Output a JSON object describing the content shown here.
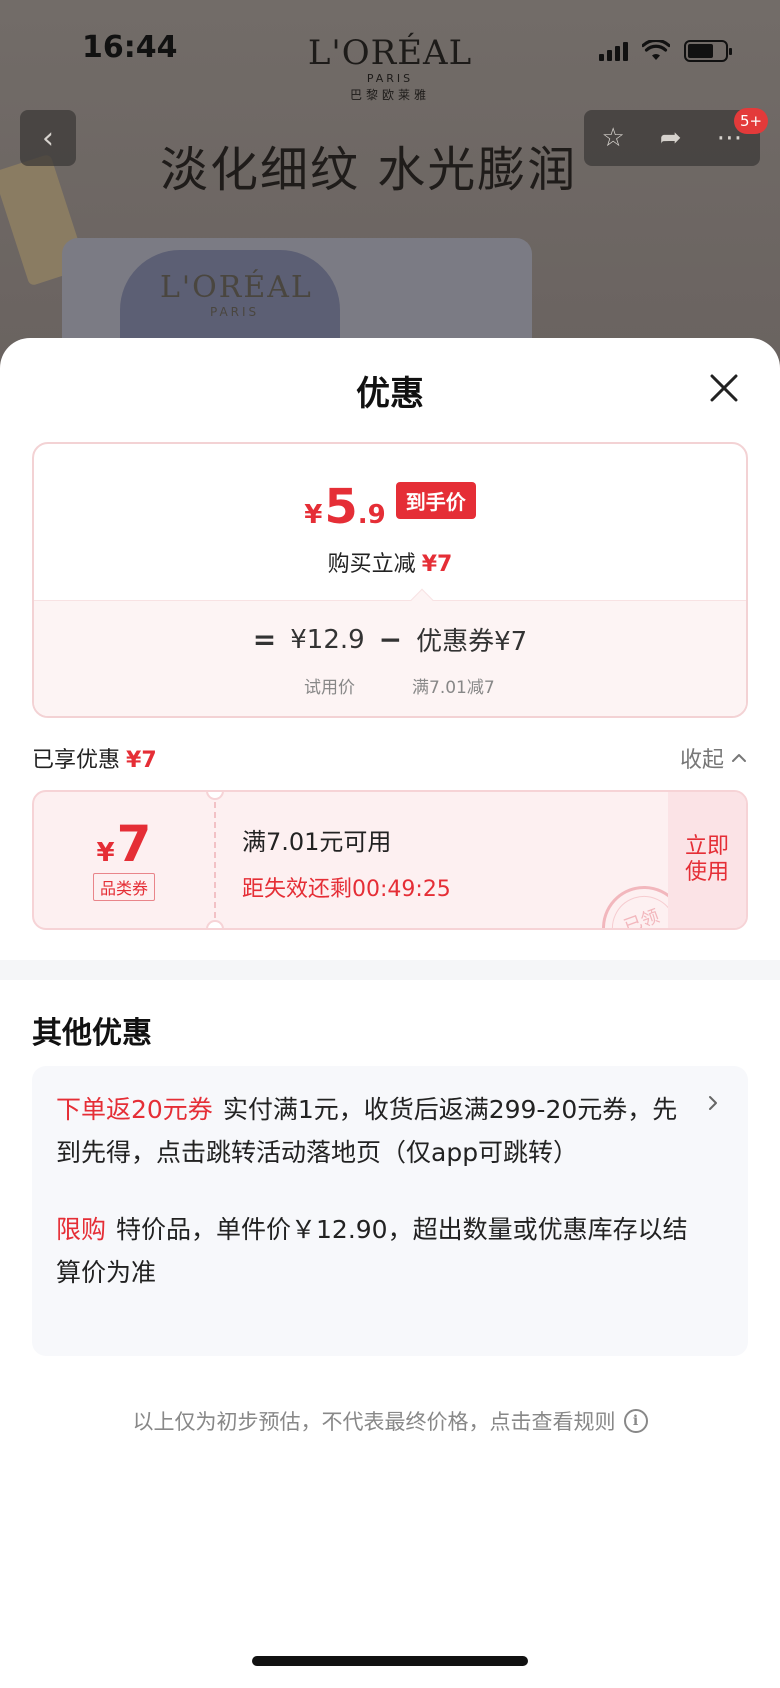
{
  "status_bar": {
    "time": "16:44"
  },
  "brand": {
    "name": "L'ORÉAL",
    "sub": "PARIS",
    "cn": "巴黎欧莱雅"
  },
  "background_page": {
    "heading": "淡化细纹 水光膨润",
    "box_brand": "L'ORÉAL",
    "box_sub": "PARIS",
    "badge": "5+",
    "icons": [
      "back-icon",
      "star-icon",
      "share-icon",
      "more-icon"
    ]
  },
  "sheet": {
    "title": "优惠",
    "price_card": {
      "currency": "¥",
      "final_int": "5",
      "final_dec": ".9",
      "final_tag": "到手价",
      "saving_label": "购买立减",
      "saving_value": "¥7",
      "eq": "=",
      "trial_price": "¥12.9",
      "minus": "−",
      "coupon_text": "优惠券¥7",
      "trial_label": "试用价",
      "coupon_rule": "满7.01减7"
    },
    "enjoyed": {
      "label": "已享优惠",
      "value": "¥7",
      "collapse": "收起"
    },
    "coupon": {
      "currency": "¥",
      "amount": "7",
      "type": "品类券",
      "condition": "满7.01元可用",
      "timer": "距失效还剩00:49:25",
      "use_label": "立即使用",
      "stamp": "已领"
    },
    "other": {
      "title": "其他优惠",
      "offers": [
        {
          "tag": "下单返20元券",
          "text": "实付满1元，收货后返满299-20元券，先到先得，点击跳转活动落地页（仅app可跳转）"
        },
        {
          "tag": "限购",
          "text": "特价品，单件价￥12.90，超出数量或优惠库存以结算价为准"
        }
      ]
    },
    "footnote": "以上仅为初步预估，不代表最终价格，点击查看规则",
    "colors": {
      "accent": "#e52e36",
      "coupon_bg": "#fdf0f1",
      "card_bg": "#f7f8fb"
    }
  }
}
